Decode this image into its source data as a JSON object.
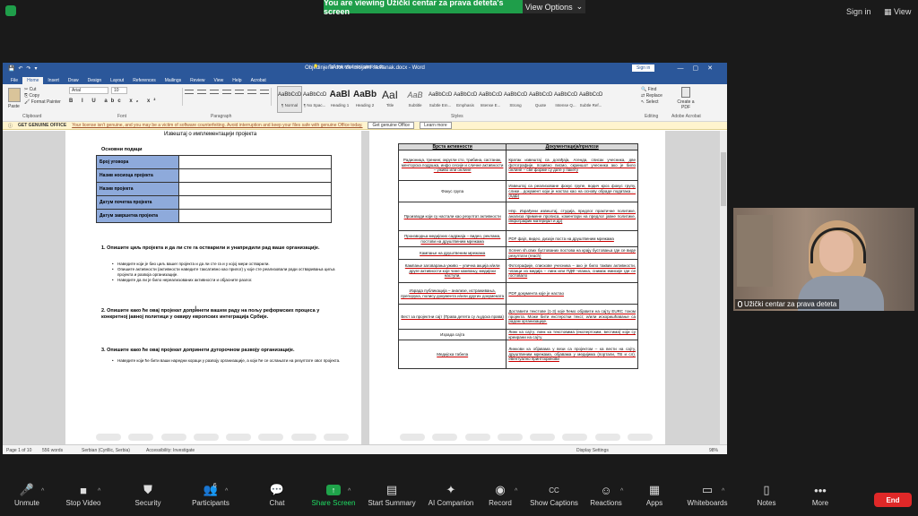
{
  "zoom": {
    "share_banner": "You are viewing Užički centar za prava deteta's screen",
    "view_options": "View Options",
    "sign_in": "Sign in",
    "view": "View"
  },
  "word": {
    "title": "Objedinjena dok za inicijalni sastanak.docx - Word",
    "sign_in": "Sign in",
    "tabs": [
      "File",
      "Home",
      "Insert",
      "Draw",
      "Design",
      "Layout",
      "References",
      "Mailings",
      "Review",
      "View",
      "Help",
      "Acrobat"
    ],
    "tell_me": "Tell me what you want to do",
    "clipboard": {
      "paste": "Paste",
      "cut": "Cut",
      "copy": "Copy",
      "format_painter": "Format Painter",
      "label": "Clipboard"
    },
    "font": {
      "name": "Arial",
      "size": "10",
      "label": "Font",
      "format_glyphs": "B I U abc x₂ x²"
    },
    "paragraph_label": "Paragraph",
    "styles": [
      {
        "preview": "AaBbCcDc",
        "name": "¶ Normal"
      },
      {
        "preview": "AaBbCcDc",
        "name": "¶ No Spac..."
      },
      {
        "preview": "AaBl",
        "name": "Heading 1"
      },
      {
        "preview": "AaBbC",
        "name": "Heading 2"
      },
      {
        "preview": "AaI",
        "name": "Title"
      },
      {
        "preview": "AaB",
        "name": "Subtitle"
      },
      {
        "preview": "AaBbCcDc",
        "name": "Subtle Em..."
      },
      {
        "preview": "AaBbCcDc",
        "name": "Emphasis"
      },
      {
        "preview": "AaBbCcDc",
        "name": "Intense E..."
      },
      {
        "preview": "AaBbCcDc",
        "name": "Strong"
      },
      {
        "preview": "AaBbCcDc",
        "name": "Quote"
      },
      {
        "preview": "AaBbCcDc",
        "name": "Intense Q..."
      },
      {
        "preview": "AaBbCcDc",
        "name": "Subtle Ref..."
      }
    ],
    "styles_label": "Styles",
    "editing": {
      "find": "Find",
      "replace": "Replace",
      "select": "Select",
      "label": "Editing"
    },
    "acrobat": {
      "create": "Create a PDF",
      "label": "Adobe Acrobat"
    },
    "notice": {
      "title": "GET GENUINE OFFICE",
      "text": "Your license isn't genuine, and you may be a victim of software counterfeiting. Avoid interruption and keep your files safe with genuine Office today.",
      "btn1": "Get genuine Office",
      "btn2": "Learn more"
    },
    "status": {
      "page": "Page 1 of 10",
      "words": "556 words",
      "lang": "Serbian (Cyrillic, Serbia)",
      "access": "Accessibility: Investigate",
      "display": "Display Settings",
      "zoom": "98%"
    }
  },
  "page1": {
    "heading": "Извештај о имплементацији пројекта",
    "basic": "Основни подаци",
    "rows": [
      "Број уговора",
      "Назив носиоца пројекта",
      "Назив пројекта",
      "Датум почетка пројекта",
      "Датум завршетка пројекта"
    ],
    "q1": "1.  Опишите циљ пројекта и да ли сте га остварили и унапредили рад ваше организације.",
    "q1_bullets": [
      "Наведите који је био циљ вашег пројекта и да ли сте га и у којој мери остварили.",
      "Опишите активности (активности наведите таксативно као прилог) у  којe сте реализовали ради остваривања циља пројекта и развоја организације.",
      "Наведите да ли је било нереализованих активности и објасните разлог."
    ],
    "q2": "2.  Опишите како ће овај пројекат допринети вашем раду на пољу реформских процеса у конкретној јавној политици у оквиру европских интеграција Србије.",
    "q3": "3.  Опишите како ће овај пројекат допринети дугорочном развоју организације.",
    "q3_bullets": [
      "Наведите који ће бити ваши наредни кораци у развоју организације, а који ће се ослањати на резултате овог пројекта."
    ]
  },
  "page2": {
    "col1": "Врста активности",
    "col2": "Документација/прилози",
    "rows": [
      [
        "Радионица, тренинг, округли сто, трибина, састанак, менторска подршка, инфо сесије и сличне активности – уживо или онлине",
        "Кратак извештај са догађаја, Агенда, списак учесника, две фотографије, позивно писмо, скриншот  учесника ако је било онлине – све форме су дате у пакету"
      ],
      [
        "Фокус група",
        "Извештај са реализоване фокус групе, водич кроз фокус групу, слике…документ који је настао као на основу обраде података….(пдф)"
      ],
      [
        "Производи који су настали као резултат активности",
        "Нпр. Израђени извештај, студија, предлог практичне политике, анализа примене прописа, коментари на предлог јавне политике, инфографик материјал и др)"
      ],
      [
        "Производња медијских садржаја – видео, реклама, постови на друштвеним мрежама",
        "PDF фајл, видео, дизајн поста на друштвеним мрежама"
      ],
      [
        "Кампање на друштвеним мрежама",
        "Screen sh.свих бустованих постова на крају бустовања где се виде резултати (reach)"
      ],
      [
        "Кампање заговарања уживо – улична акција и/или друге активности које чине кампању, медијски наступи.",
        "Фотографије, спискове учесника – ако је било таквих активности, чланци из медија – линк или ПДФ чланка, снимак емисије где се гостовало"
      ],
      [
        "Израда публикација – анализе, истраживања, препорука, полису документа и/или других докумената",
        "PDF документа које је настао"
      ],
      [
        "Вест за пројектни сајт (Права детета су људска права)",
        "Доставити текстове (1-3) које ћемо објавити на сајту EURC током пројекта. Може бити екстерстки текст, и/или искоришћавање са радом организације."
      ],
      [
        "Израда сајта",
        "Линк ка сајту, линк ка текстовима (експертским, вестима) који су креирани на сајту."
      ],
      [
        "Медијска табела",
        "Линкови ка објавама у вези са пројектом – ка вести на сајту, друштвеним мрежама, објавама у медијима (портали, ТВ и сл). евентуално принтскринови"
      ]
    ]
  },
  "video": {
    "name": "Užički centar za prava deteta"
  },
  "toolbar": [
    {
      "name": "Unmute",
      "icon": "🎤"
    },
    {
      "name": "Stop Video",
      "icon": "■"
    },
    {
      "name": "Security",
      "icon": "⛊"
    },
    {
      "name": "Participants",
      "icon": "👥",
      "count": "6"
    },
    {
      "name": "Chat",
      "icon": "💬"
    },
    {
      "name": "Share Screen",
      "icon": "↑"
    },
    {
      "name": "Start Summary",
      "icon": "▤"
    },
    {
      "name": "AI Companion",
      "icon": "✦"
    },
    {
      "name": "Record",
      "icon": "◉"
    },
    {
      "name": "Show Captions",
      "icon": "CC"
    },
    {
      "name": "Reactions",
      "icon": "☺"
    },
    {
      "name": "Apps",
      "icon": "▦"
    },
    {
      "name": "Whiteboards",
      "icon": "▭"
    },
    {
      "name": "Notes",
      "icon": "▯"
    },
    {
      "name": "More",
      "icon": "•••"
    }
  ],
  "end": "End",
  "colors": {
    "word_blue": "#2b579a",
    "zoom_green": "#1f9e4a",
    "end_red": "#e02828",
    "table_header_blue": "#8eaadb"
  }
}
